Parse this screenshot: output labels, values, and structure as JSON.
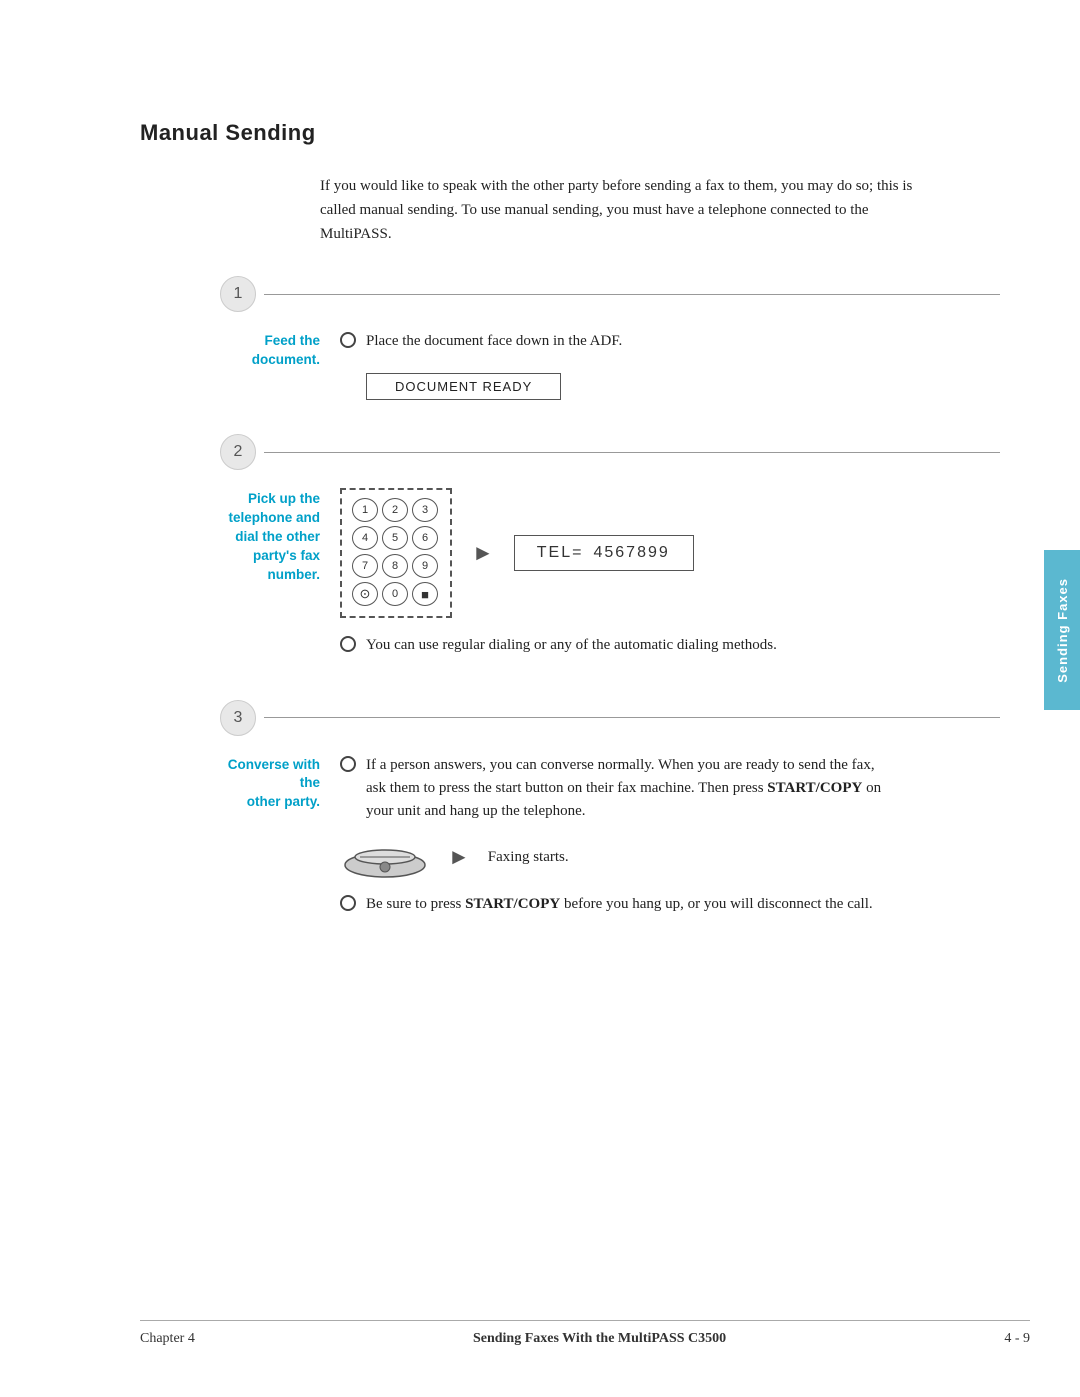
{
  "page": {
    "title": "Manual Sending",
    "intro": "If you would like to speak with the other party before sending a fax to them, you may do so; this is called manual sending. To use manual sending, you must have a telephone connected to the MultiPASS."
  },
  "steps": [
    {
      "number": "1",
      "label": "Feed the\ndocument.",
      "bullets": [
        {
          "text": "Place the document face down in the ADF.",
          "show_doc_ready": true
        }
      ]
    },
    {
      "number": "2",
      "label": "Pick up the\ntelephone and\ndial the other\nparty's fax\nnumber.",
      "bullets": [
        {
          "text": "You can use regular dialing or any of the automatic dialing methods.",
          "show_keypad_tel": true
        }
      ],
      "keypad": {
        "keys": [
          "1",
          "2",
          "3",
          "4",
          "5",
          "6",
          "7",
          "8",
          "9",
          "•",
          "0",
          "■"
        ],
        "tel_label": "TEL=",
        "tel_number": "4567899"
      }
    },
    {
      "number": "3",
      "label": "Converse with the\nother party.",
      "bullets": [
        {
          "text": "If a person answers, you can converse normally. When you are ready to send the fax, ask them to press the start button on their fax machine. Then press START/COPY on your unit and hang up the telephone.",
          "show_fax": true,
          "fax_starts_text": "Faxing starts."
        },
        {
          "text": "Be sure to press START/COPY before you hang up, or you will disconnect the call.",
          "bold_parts": [
            "START/COPY"
          ]
        }
      ]
    }
  ],
  "sidebar": {
    "label": "Sending Faxes"
  },
  "footer": {
    "left": "Chapter 4",
    "center": "Sending Faxes With the MultiPASS C3500",
    "right": "4 - 9"
  },
  "doc_ready_label": "DOCUMENT READY"
}
